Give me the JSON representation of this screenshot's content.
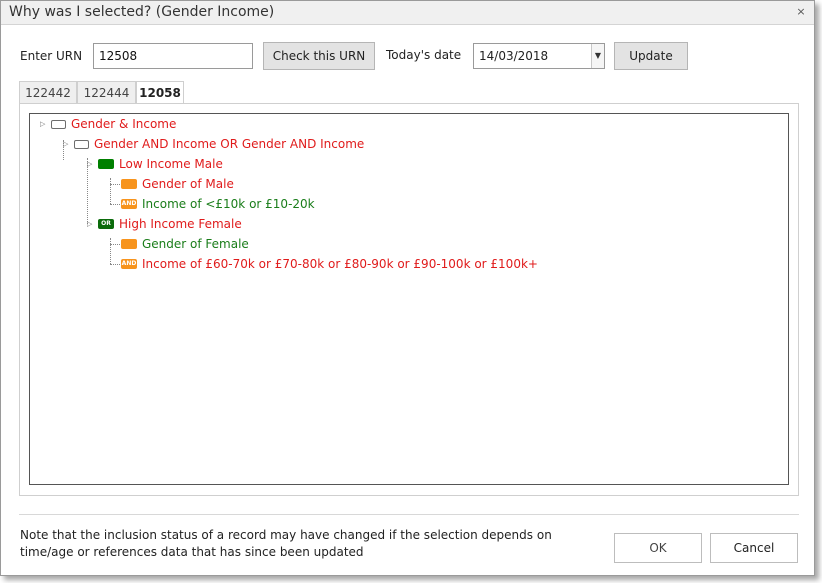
{
  "window": {
    "title": "Why was I selected? (Gender  Income)",
    "close_glyph": "×"
  },
  "form": {
    "urn_label": "Enter URN",
    "urn_value": "12508",
    "check_button": "Check this URN",
    "date_label": "Today's date",
    "date_value": "14/03/2018",
    "update_button": "Update"
  },
  "tabs": [
    {
      "label": "122442",
      "active": false
    },
    {
      "label": "122444",
      "active": false
    },
    {
      "label": "12058",
      "active": true
    }
  ],
  "tree": {
    "root": {
      "label": "Gender & Income",
      "icon": "frame-icon",
      "color": "#e01b1b"
    },
    "group": {
      "label": "Gender AND Income OR Gender AND Income",
      "icon": "frame-icon",
      "color": "#e01b1b"
    },
    "low_income_male": {
      "label": "Low Income Male",
      "icon": "green-block-icon",
      "color": "#e01b1b"
    },
    "gender_male": {
      "label": "Gender of Male",
      "icon": "orange-block-icon",
      "color": "#e01b1b"
    },
    "income_low": {
      "label": "Income of <£10k or £10-20k",
      "icon": "and-badge-icon",
      "badge": "AND",
      "color": "#1a7d1a"
    },
    "high_income_female": {
      "label": "High Income Female",
      "icon": "or-badge-icon",
      "badge": "OR",
      "color": "#e01b1b"
    },
    "gender_female": {
      "label": "Gender of Female",
      "icon": "orange-block-icon",
      "color": "#1a7d1a"
    },
    "income_high": {
      "label": "Income of £60-70k or £70-80k or £80-90k or £90-100k or £100k+",
      "icon": "and-badge-icon",
      "badge": "AND",
      "color": "#e01b1b"
    }
  },
  "footer": {
    "note": "Note that the inclusion status of a record may have changed if the selection depends on time/age or references data that has since been updated",
    "ok_button": "OK",
    "cancel_button": "Cancel"
  }
}
